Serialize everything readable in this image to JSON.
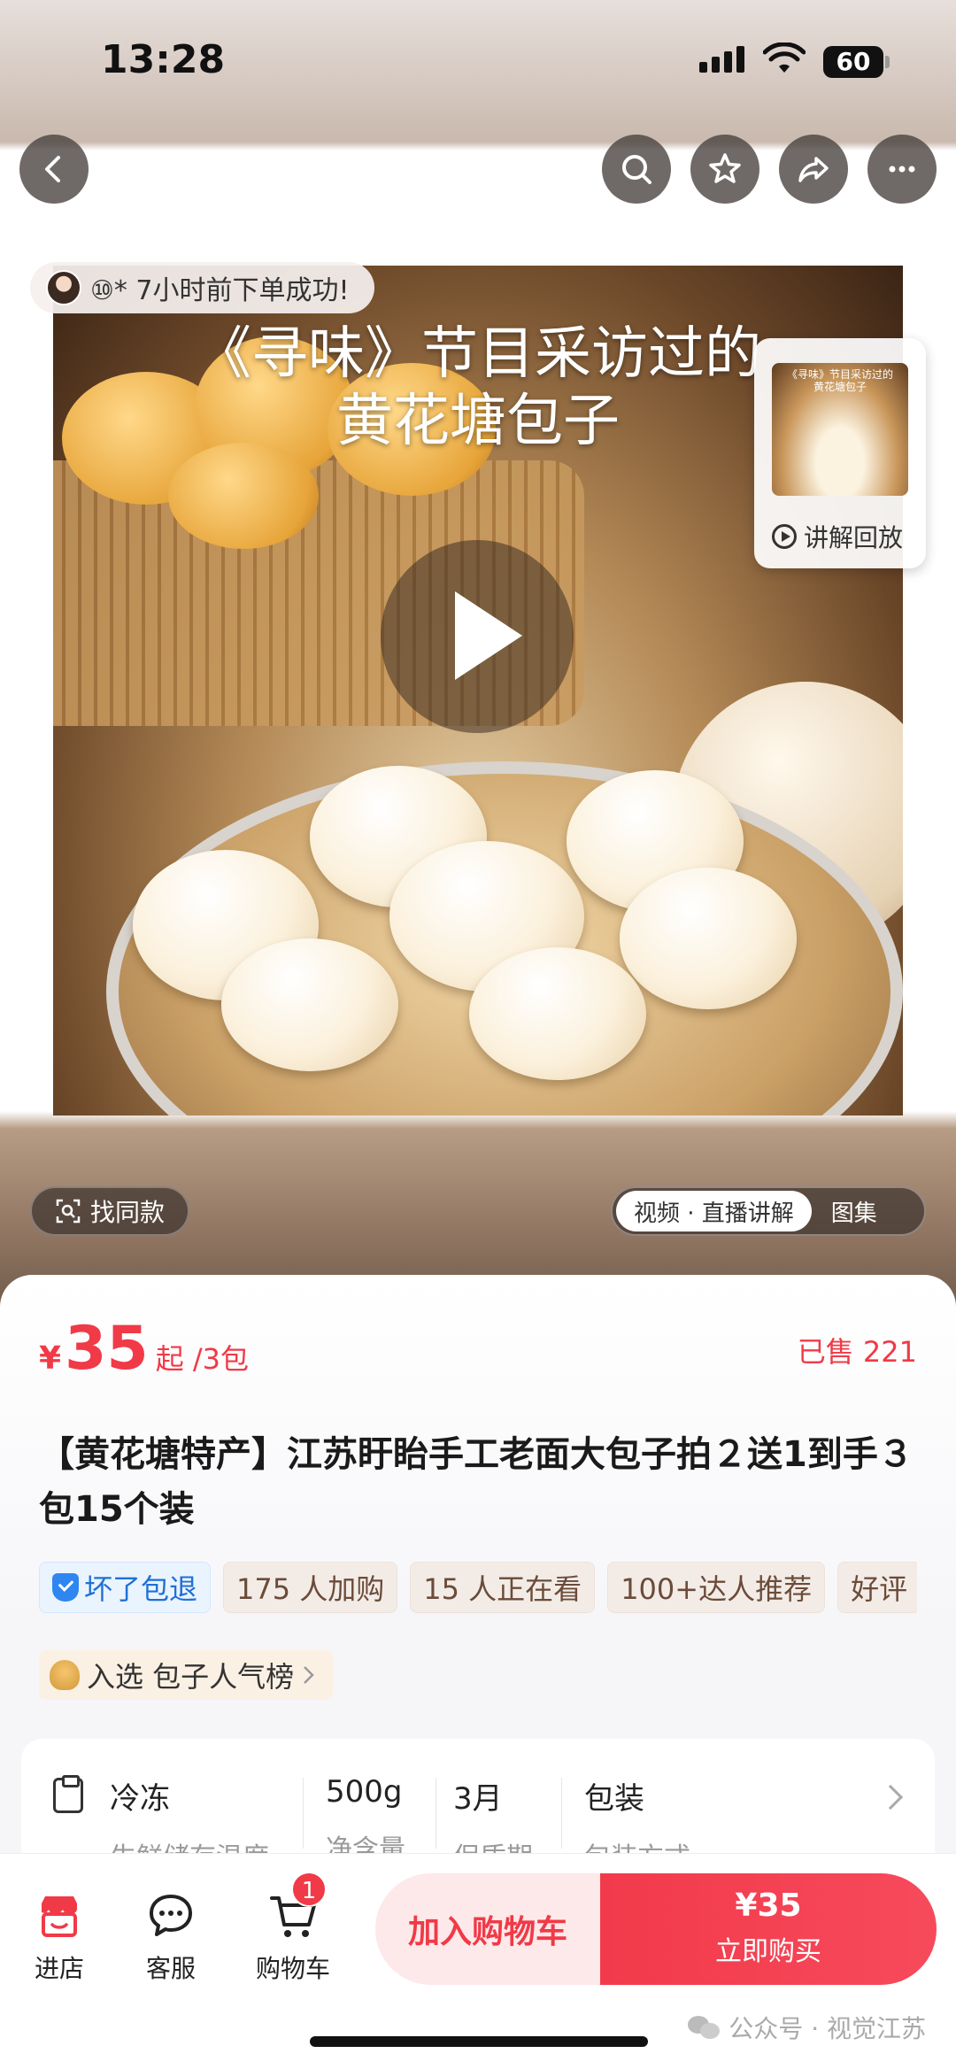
{
  "status_bar": {
    "time": "13:28",
    "battery": "60"
  },
  "header": {
    "icons": [
      "back-icon",
      "search-icon",
      "star-icon",
      "share-icon",
      "more-icon"
    ]
  },
  "hero": {
    "order_notice": "⑩* 7小时前下单成功!",
    "video_title_line1": "《寻味》节目采访过的",
    "video_title_line2": "黄花塘包子",
    "replay": {
      "thumb_line1": "《寻味》节目采访过的",
      "thumb_line2": "黄花塘包子",
      "label": "讲解回放"
    },
    "find_same": "找同款",
    "media_tabs": {
      "active": "视频 · 直播讲解",
      "other": "图集"
    }
  },
  "product": {
    "price_symbol": "¥",
    "price": "35",
    "price_suffix": "起 /3包",
    "sold": "已售 221",
    "title": "【黄花塘特产】江苏盱眙手工老面大包子拍２送1到手３包15个装",
    "tags": [
      {
        "label": "坏了包退",
        "type": "guarantee"
      },
      {
        "label": "175 人加购"
      },
      {
        "label": "15 人正在看"
      },
      {
        "label": "100+达人推荐"
      },
      {
        "label": "好评"
      }
    ],
    "ranking": "入选 包子人气榜",
    "specs": [
      {
        "value": "冷冻",
        "key": "生鲜储存温度"
      },
      {
        "value": "500g",
        "key": "净含量"
      },
      {
        "value": "3月",
        "key": "保质期"
      },
      {
        "value": "包装",
        "key": "包装方式"
      }
    ]
  },
  "bottom_bar": {
    "shop": "进店",
    "service": "客服",
    "cart": "购物车",
    "cart_count": "1",
    "add_to_cart": "加入购物车",
    "buy_price": "¥35",
    "buy_label": "立即购买"
  },
  "watermark": "公众号 · 视觉江苏",
  "colors": {
    "accent": "#f03a47",
    "guarantee_blue": "#1f70d6"
  }
}
